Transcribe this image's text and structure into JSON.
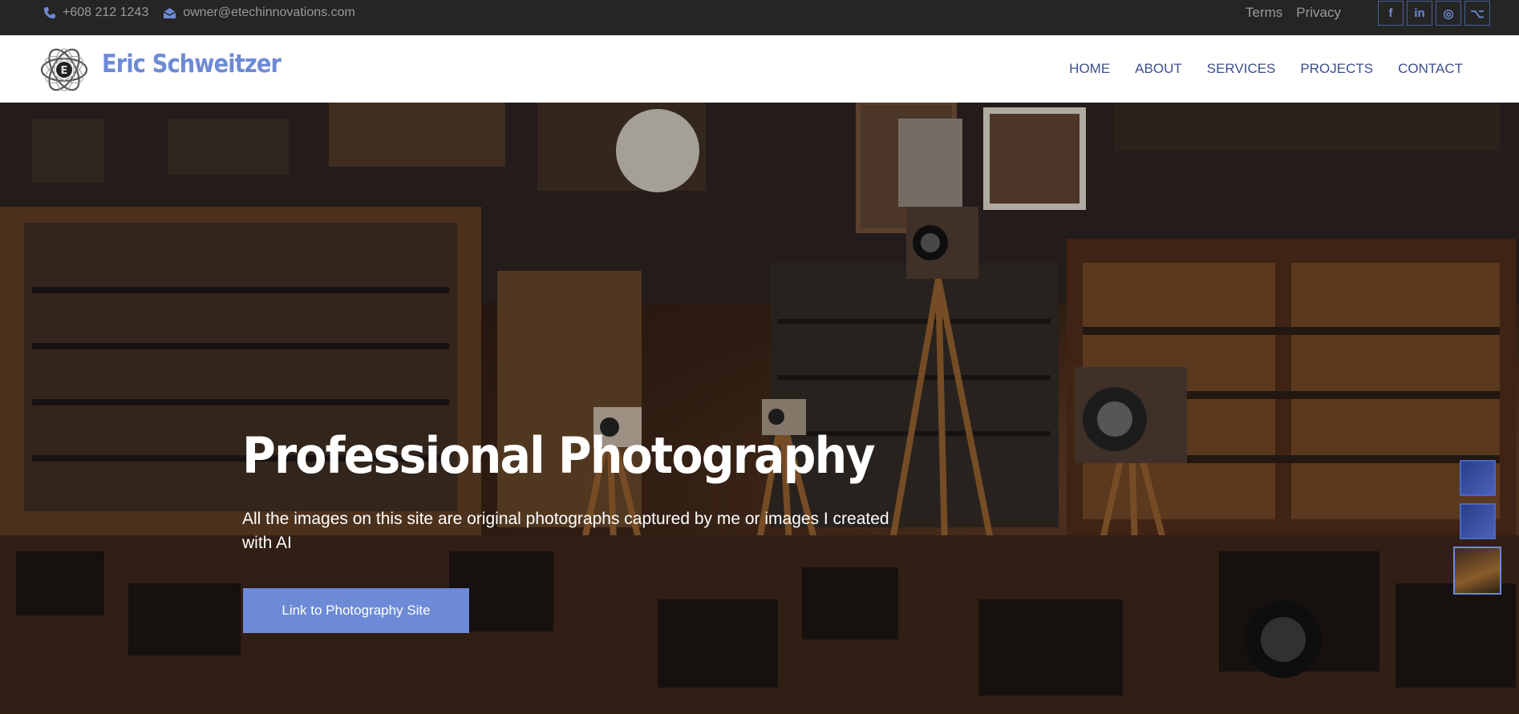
{
  "topbar": {
    "phone": "+608 212 1243",
    "email": "owner@etechinnovations.com",
    "links": [
      "Terms",
      "Privacy"
    ],
    "social_icons": [
      "facebook-icon",
      "linkedin-icon",
      "instagram-icon",
      "github-icon"
    ],
    "social_glyphs": [
      "f",
      "in",
      "◎",
      "⌥"
    ]
  },
  "header": {
    "brand": "Eric Schweitzer",
    "nav": [
      "HOME",
      "ABOUT",
      "SERVICES",
      "PROJECTS",
      "CONTACT"
    ]
  },
  "hero": {
    "title": "Professional Photography",
    "subtitle": "All the images on this site are original photographs captured by me or images I created with AI",
    "button_label": "Link to Photography Site"
  },
  "colors": {
    "accent": "#6d8ad6",
    "nav_text": "#3b4f8f",
    "topbar_bg": "#252525"
  }
}
